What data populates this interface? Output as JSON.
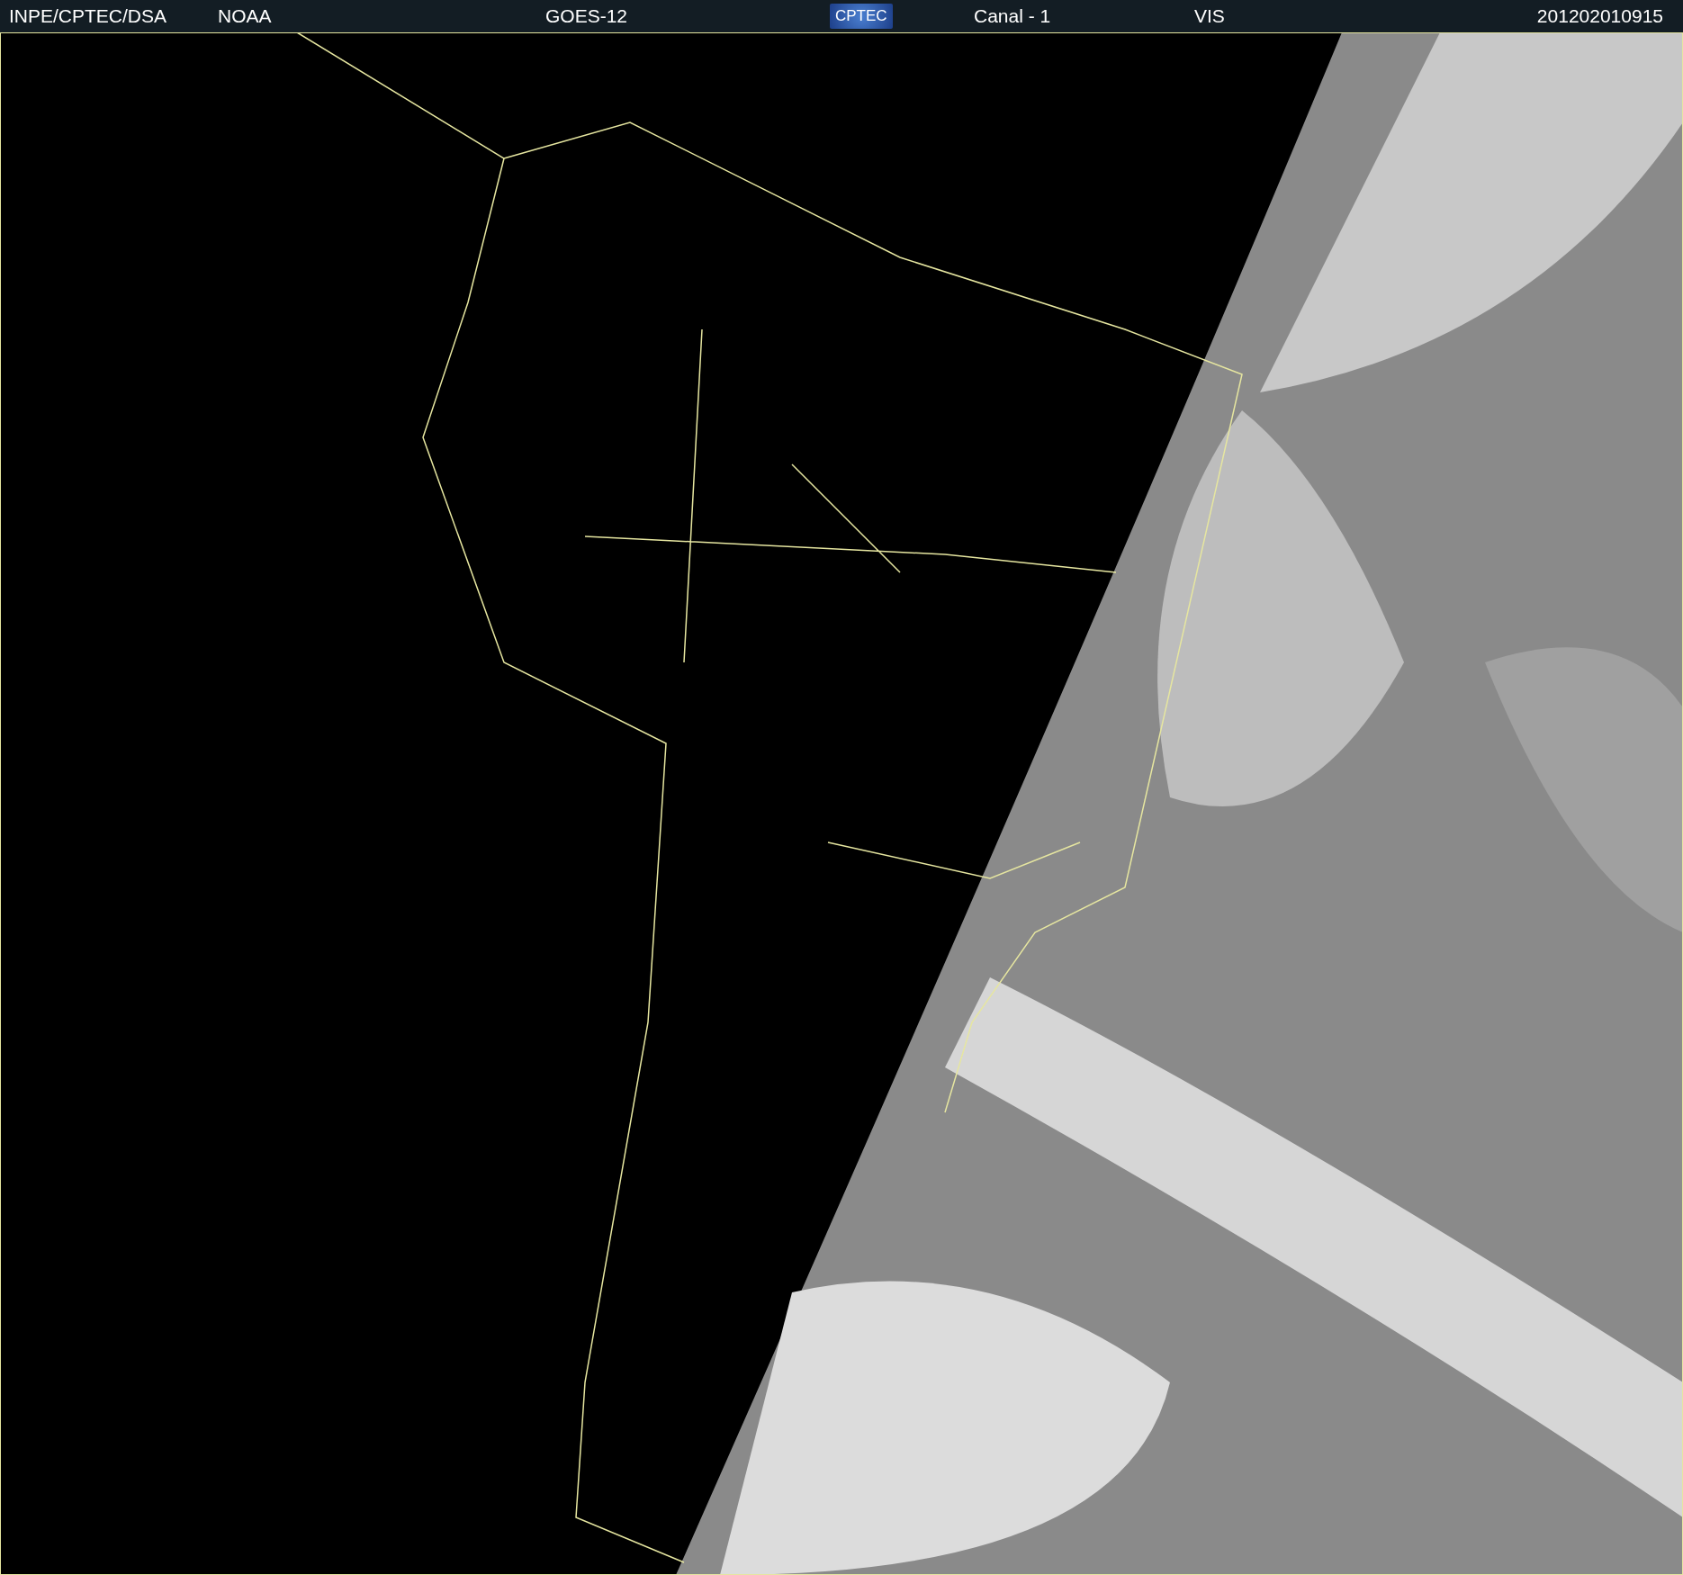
{
  "header": {
    "items": [
      {
        "kind": "text",
        "text": "INPE/CPTEC/DSA"
      },
      {
        "kind": "text",
        "text": "NOAA"
      },
      {
        "kind": "text",
        "text": "GOES-12"
      },
      {
        "kind": "logo",
        "text": "CPTEC"
      },
      {
        "kind": "text",
        "text": "Canal - 1"
      },
      {
        "kind": "text",
        "text": "VIS"
      },
      {
        "kind": "text",
        "text": "201202010915"
      }
    ]
  }
}
